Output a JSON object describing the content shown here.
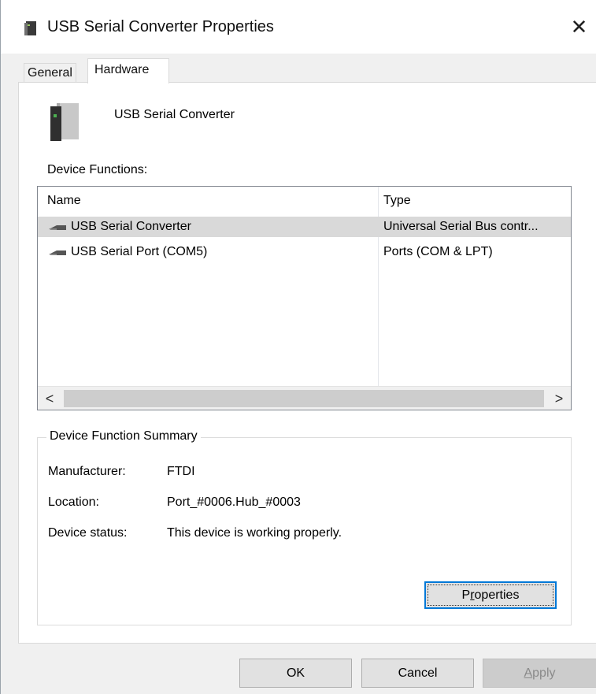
{
  "window": {
    "title": "USB Serial Converter Properties",
    "close_glyph": "✕"
  },
  "tabs": [
    {
      "label": "General",
      "active": false
    },
    {
      "label": "Hardware",
      "active": true
    }
  ],
  "device": {
    "name": "USB Serial Converter",
    "icon": "usb-device-icon"
  },
  "functions": {
    "label": "Device Functions:",
    "columns": [
      "Name",
      "Type"
    ],
    "rows": [
      {
        "name": "USB Serial Converter",
        "type": "Universal Serial Bus contr...",
        "selected": true,
        "icon": "usb-plug-icon"
      },
      {
        "name": "USB Serial Port (COM5)",
        "type": "Ports (COM & LPT)",
        "selected": false,
        "icon": "usb-plug-icon"
      }
    ],
    "scroll_left": "<",
    "scroll_right": ">"
  },
  "summary": {
    "legend": "Device Function Summary",
    "manufacturer_label": "Manufacturer:",
    "manufacturer_value": "FTDI",
    "location_label": "Location:",
    "location_value": "Port_#0006.Hub_#0003",
    "status_label": "Device status:",
    "status_value": "This device is working properly.",
    "properties_button": {
      "before": "P",
      "accel": "r",
      "after": "operties"
    }
  },
  "buttons": {
    "ok": "OK",
    "cancel": "Cancel",
    "apply": {
      "accel": "A",
      "after": "pply"
    }
  },
  "colors": {
    "selected_row": "#d9d9d9",
    "focus_border": "#0078d7",
    "disabled_text": "#8a8a8a"
  }
}
